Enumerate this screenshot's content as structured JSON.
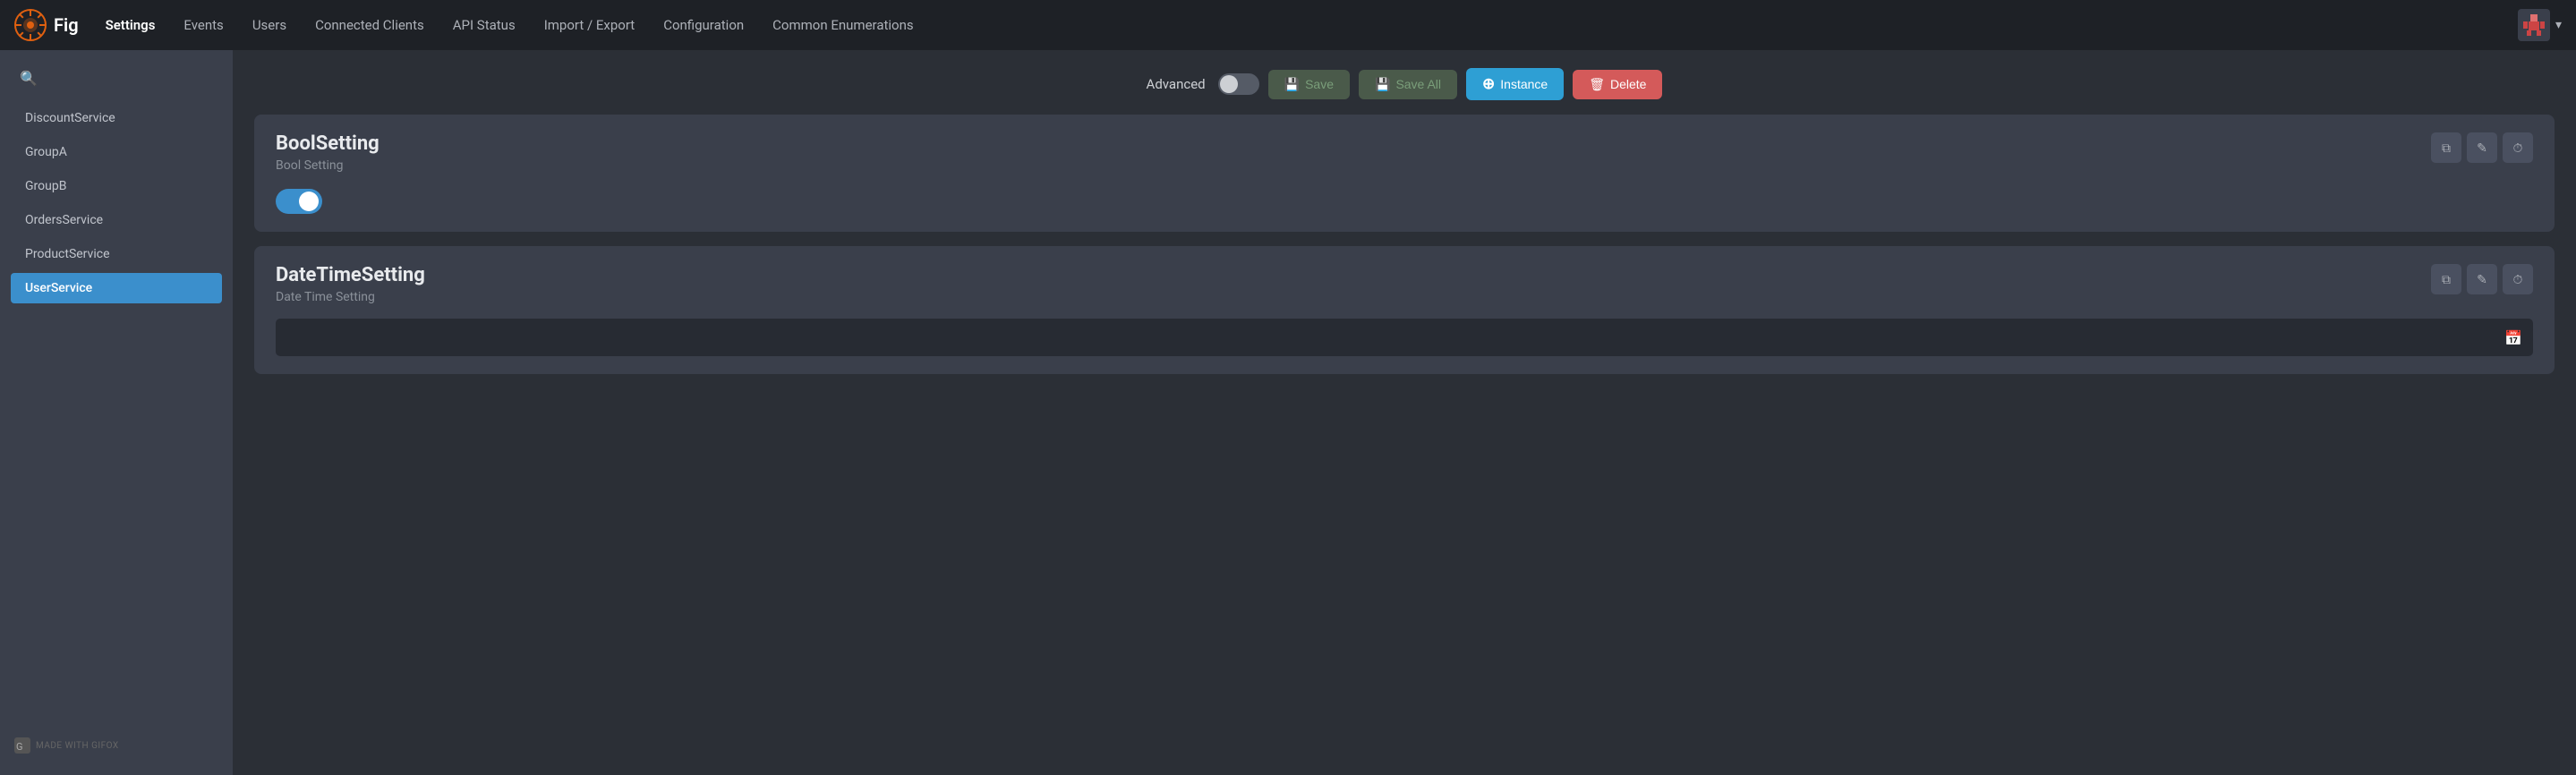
{
  "app": {
    "logo_text": "Fig",
    "nav_items": [
      {
        "label": "Settings",
        "active": true
      },
      {
        "label": "Events",
        "active": false
      },
      {
        "label": "Users",
        "active": false
      },
      {
        "label": "Connected Clients",
        "active": false
      },
      {
        "label": "API Status",
        "active": false
      },
      {
        "label": "Import / Export",
        "active": false
      },
      {
        "label": "Configuration",
        "active": false
      },
      {
        "label": "Common Enumerations",
        "active": false
      }
    ]
  },
  "sidebar": {
    "search_placeholder": "Search",
    "items": [
      {
        "label": "DiscountService",
        "active": false
      },
      {
        "label": "GroupA",
        "active": false
      },
      {
        "label": "GroupB",
        "active": false
      },
      {
        "label": "OrdersService",
        "active": false
      },
      {
        "label": "ProductService",
        "active": false
      },
      {
        "label": "UserService",
        "active": true
      }
    ],
    "footer_label": "Made with Gifox"
  },
  "toolbar": {
    "advanced_label": "Advanced",
    "save_label": "Save",
    "save_all_label": "Save All",
    "instance_label": "Instance",
    "delete_label": "Delete"
  },
  "cards": [
    {
      "id": "bool-setting",
      "title": "BoolSetting",
      "subtitle": "Bool Setting",
      "type": "bool",
      "value": true
    },
    {
      "id": "datetime-setting",
      "title": "DateTimeSetting",
      "subtitle": "Date Time Setting",
      "type": "datetime",
      "value": ""
    }
  ],
  "icons": {
    "save": "💾",
    "instance_plus": "⊕",
    "delete": "🗑",
    "copy": "⧉",
    "edit": "✎",
    "history": "⏱",
    "calendar": "📅",
    "search": "🔍",
    "chevron_down": "▾"
  },
  "colors": {
    "accent_blue": "#2e9fd4",
    "accent_red": "#d45a5a",
    "active_nav": "#3b8fcc",
    "card_bg": "#3a3f4b",
    "sidebar_bg": "#3a3f4b",
    "nav_bg": "#1e2126"
  }
}
